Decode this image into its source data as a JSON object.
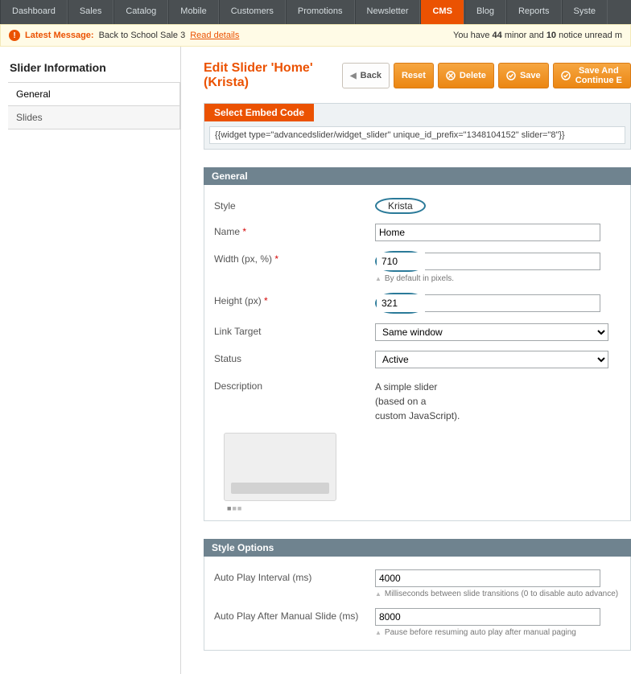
{
  "nav": {
    "items": [
      {
        "label": "Dashboard",
        "active": false
      },
      {
        "label": "Sales",
        "active": false
      },
      {
        "label": "Catalog",
        "active": false
      },
      {
        "label": "Mobile",
        "active": false
      },
      {
        "label": "Customers",
        "active": false
      },
      {
        "label": "Promotions",
        "active": false
      },
      {
        "label": "Newsletter",
        "active": false
      },
      {
        "label": "CMS",
        "active": true
      },
      {
        "label": "Blog",
        "active": false
      },
      {
        "label": "Reports",
        "active": false
      },
      {
        "label": "Syste",
        "active": false
      }
    ]
  },
  "notice": {
    "label": "Latest Message:",
    "message": "Back to School Sale 3",
    "link": "Read details",
    "right_prefix": "You have ",
    "minor_count": "44",
    "right_mid": " minor and ",
    "notice_count": "10",
    "right_suffix": " notice unread m"
  },
  "sidebar": {
    "title": "Slider Information",
    "tabs": [
      {
        "label": "General",
        "active": true
      },
      {
        "label": "Slides",
        "active": false
      }
    ]
  },
  "page": {
    "title": "Edit Slider 'Home' (Krista)"
  },
  "buttons": {
    "back": "Back",
    "reset": "Reset",
    "delete": "Delete",
    "save": "Save",
    "save_continue": "Save And Continue E"
  },
  "embed": {
    "title": "Select Embed Code",
    "code": "{{widget type=\"advancedslider/widget_slider\" unique_id_prefix=\"1348104152\" slider=\"8\"}}"
  },
  "general": {
    "title": "General",
    "rows": {
      "style": {
        "label": "Style",
        "value": "Krista"
      },
      "name": {
        "label": "Name",
        "value": "Home",
        "required": true
      },
      "width": {
        "label": "Width (px, %)",
        "value": "710",
        "required": true,
        "help": "By default in pixels."
      },
      "height": {
        "label": "Height (px)",
        "value": "321",
        "required": true
      },
      "link_target": {
        "label": "Link Target",
        "value": "Same window"
      },
      "status": {
        "label": "Status",
        "value": "Active"
      },
      "description": {
        "label": "Description",
        "value": "A simple slider\n(based on a\ncustom JavaScript)."
      }
    }
  },
  "style_options": {
    "title": "Style Options",
    "rows": {
      "interval": {
        "label": "Auto Play Interval (ms)",
        "value": "4000",
        "help": "Milliseconds between slide transitions (0 to disable auto advance)"
      },
      "after_manual": {
        "label": "Auto Play After Manual Slide (ms)",
        "value": "8000",
        "help": "Pause before resuming auto play after manual paging"
      }
    }
  }
}
